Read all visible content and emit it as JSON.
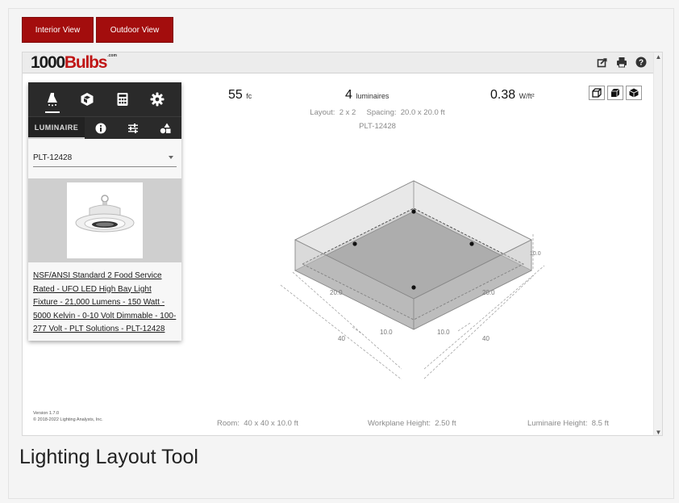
{
  "view_tabs": {
    "interior": "Interior View",
    "outdoor": "Outdoor View"
  },
  "logo": {
    "prefix": "1000",
    "brand": "Bulbs",
    "suffix": ".com"
  },
  "panel": {
    "subtab_label": "LUMINAIRE",
    "selected_product": "PLT-12428",
    "description": "NSF/ANSI Standard 2 Food Service Rated - UFO LED High Bay Light Fixture - 21,000 Lumens - 150 Watt - 5000 Kelvin - 0-10 Volt Dimmable - 100-277 Volt - PLT Solutions - PLT-12428"
  },
  "metrics": {
    "illuminance_value": "55",
    "illuminance_unit": "fc",
    "luminaire_count": "4",
    "luminaire_unit": "luminaires",
    "power_density_value": "0.38",
    "power_density_unit": "W/ft²",
    "layout_text": "Layout:  2 x 2     Spacing:  20.0 x 20.0 ft",
    "product_code": "PLT-12428"
  },
  "room_labels": {
    "length_inner": "20.0",
    "width_inner": "20.0",
    "length_outer": "40",
    "width_outer": "40",
    "half_left": "10.0",
    "half_right": "10.0",
    "height": "10.0"
  },
  "footer": {
    "room": "Room:  40 x 40 x 10.0 ft",
    "workplane": "Workplane Height:  2.50 ft",
    "luminaire_height": "Luminaire Height:  8.5 ft"
  },
  "version": {
    "line1": "Version 1.7.0",
    "line2": "© 2018-2022 Lighting Analysts, Inc."
  },
  "caption": "Lighting Layout Tool",
  "colors": {
    "accent": "#a30d0d",
    "brand_red": "#c01616",
    "panel_dark": "#2a2a2a"
  },
  "icons": {
    "panel_tabs": [
      "lamp-icon",
      "cube-icon",
      "calculator-icon",
      "gear-icon"
    ],
    "subtabs": [
      "info-icon",
      "sliders-icon",
      "shapes-icon"
    ],
    "top_bar": [
      "share-icon",
      "print-icon",
      "help-icon"
    ],
    "view_modes": [
      "front-view-icon",
      "side-view-icon",
      "iso-view-icon"
    ]
  }
}
